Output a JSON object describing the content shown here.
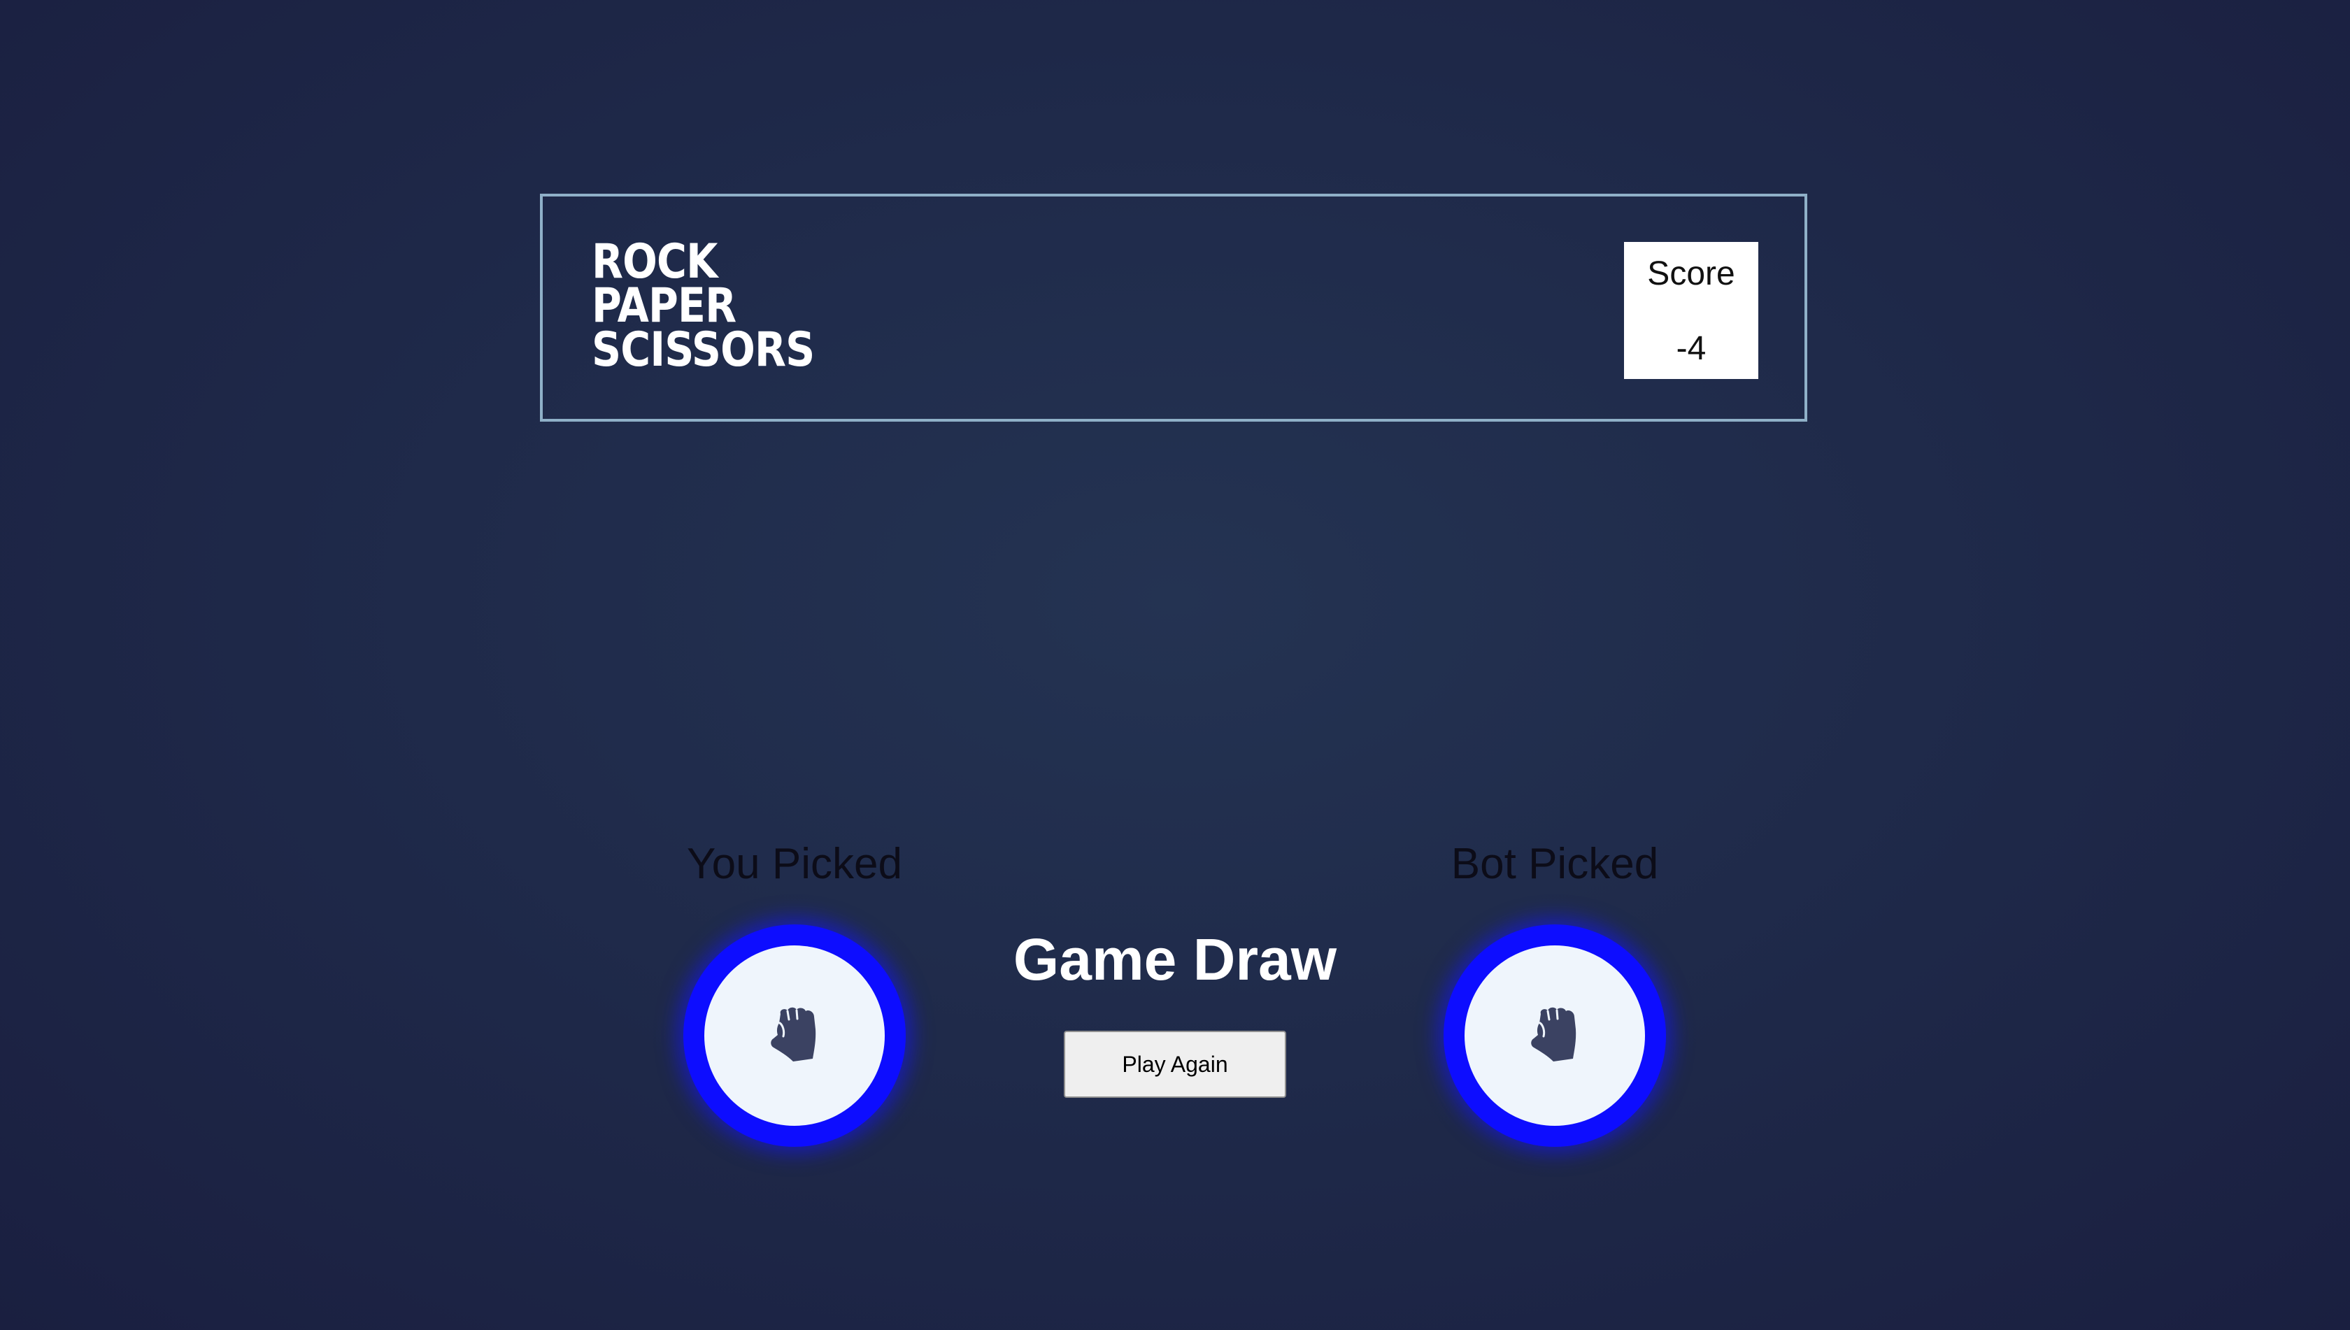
{
  "header": {
    "title_lines": [
      "ROCK",
      "PAPER",
      "SCISSORS"
    ],
    "score_label": "Score",
    "score_value": "-4"
  },
  "game": {
    "you_label": "You Picked",
    "bot_label": "Bot Picked",
    "you_pick_icon": "rock-fist-icon",
    "bot_pick_icon": "rock-fist-icon",
    "result_text": "Game Draw",
    "play_again_label": "Play Again"
  },
  "colors": {
    "background": "#1f2a4a",
    "header_border": "#8fb0c8",
    "token_ring": "#0d0dff",
    "token_face": "#eff5fc",
    "icon_fill": "#3b4262"
  }
}
